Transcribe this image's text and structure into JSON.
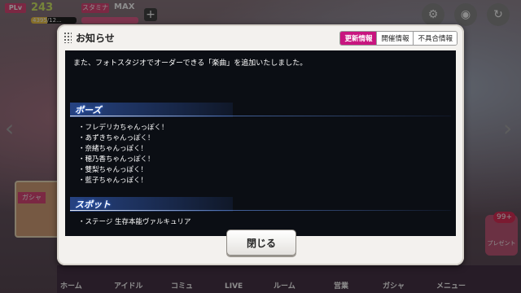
{
  "hud": {
    "plv_label": "PLv",
    "level": "243",
    "exp_text": "4395/12...",
    "stamina_label": "スタミナ",
    "stamina_value": "MAX",
    "plus_icon": "plus-icon"
  },
  "top_right_icons": [
    "gear-icon",
    "camera-icon",
    "refresh-icon"
  ],
  "side": {
    "gacha_label": "ガシャ",
    "present_label": "プレゼント",
    "present_badge": "99+"
  },
  "nav": {
    "items": [
      "ホーム",
      "アイドル",
      "コミュ",
      "LIVE",
      "ルーム",
      "営業",
      "ガシャ",
      "メニュー"
    ]
  },
  "dialog": {
    "title": "お知らせ",
    "tabs": [
      {
        "label": "更新情報",
        "active": true
      },
      {
        "label": "開催情報",
        "active": false
      },
      {
        "label": "不具合情報",
        "active": false
      }
    ],
    "intro": "また、フォトスタジオでオーダーできる「楽曲」を追加いたしました。",
    "sections": [
      {
        "heading": "ポーズ",
        "items": [
          "・フレデリカちゃんっぽく！",
          "・あずきちゃんっぽく！",
          "・奈緒ちゃんっぽく！",
          "・穂乃香ちゃんっぽく！",
          "・雙梨ちゃんっぽく！",
          "・藍子ちゃんっぽく！"
        ]
      },
      {
        "heading": "スポット",
        "items": [
          "・ステージ 生存本能ヴァルキュリア"
        ]
      }
    ],
    "close_label": "閉じる"
  },
  "colors": {
    "tab_active": "#c8157f",
    "content_bg": "#0b0e14",
    "section_glow": "#3a7bff"
  }
}
